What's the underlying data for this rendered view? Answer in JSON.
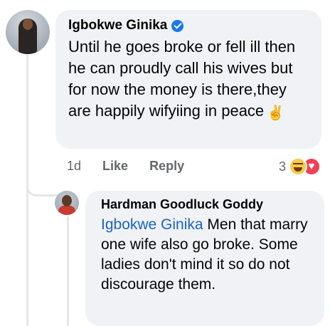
{
  "comment": {
    "author": "Igbokwe Ginika",
    "verified": true,
    "text": "Until he goes broke or fell ill then he can proudly call his wives but for now the money is there,they are happily wifyiing in peace",
    "emoji": "✌",
    "time": "1d",
    "like_label": "Like",
    "reply_label": "Reply",
    "reaction_count": "3",
    "reactions": [
      "haha-icon",
      "love-icon"
    ]
  },
  "reply": {
    "author": "Hardman Goodluck Goddy",
    "mention": "Igbokwe Ginika",
    "text": " Men that marry one wife also go broke. Some ladies don't mind it so do not discourage them."
  },
  "colors": {
    "bubble": "#f0f2f5",
    "mention": "#1b62c9",
    "secondary_text": "#65676b",
    "verified": "#1877f2"
  }
}
